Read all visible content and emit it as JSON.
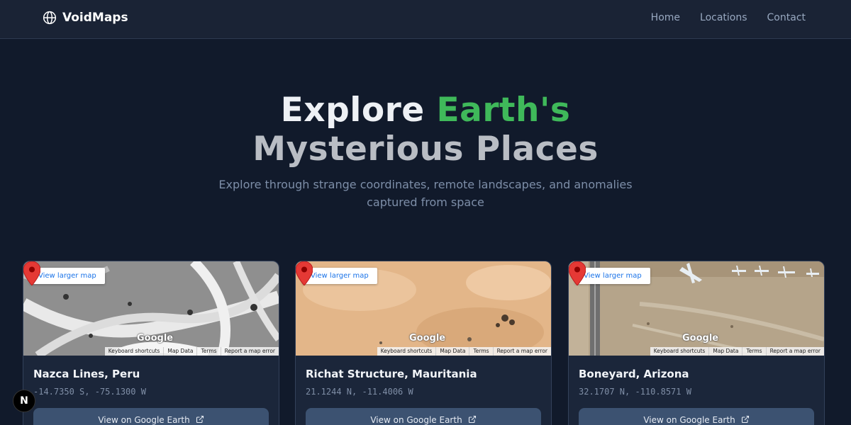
{
  "nav": {
    "brand": "VoidMaps",
    "brand_icon": "globe-icon",
    "links": [
      "Home",
      "Locations",
      "Contact"
    ]
  },
  "hero": {
    "title_part1": "Explore ",
    "title_accent": "Earth's",
    "title_line2": "Mysterious Places",
    "subtitle": "Explore through strange coordinates, remote landscapes, and anomalies captured from space"
  },
  "map_ui": {
    "larger_map": "View larger map",
    "google": "Google",
    "attribution": [
      "Keyboard shortcuts",
      "Map Data",
      "Terms",
      "Report a map error"
    ]
  },
  "cards": [
    {
      "title": "Nazca Lines, Peru",
      "coords": "-14.7350 S, -75.1300 W",
      "button": "View on Google Earth"
    },
    {
      "title": "Richat Structure, Mauritania",
      "coords": "21.1244 N, -11.4006 W",
      "button": "View on Google Earth"
    },
    {
      "title": "Boneyard, Arizona",
      "coords": "32.1707 N, -110.8571 W",
      "button": "View on Google Earth"
    }
  ],
  "badge": "N",
  "colors": {
    "accent": "#3fb95a",
    "background": "#111a2b",
    "button": "#3c5271"
  }
}
